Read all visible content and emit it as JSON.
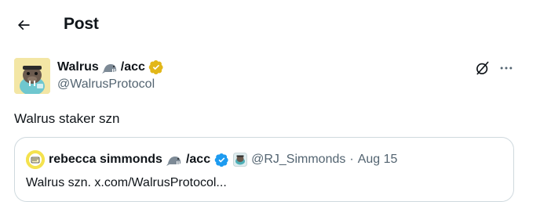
{
  "header": {
    "title": "Post"
  },
  "author": {
    "name": "Walrus",
    "name_suffix": "/acc",
    "handle": "@WalrusProtocol",
    "badge_color": "#e2b719"
  },
  "post": {
    "text": "Walrus staker szn"
  },
  "quoted": {
    "name": "rebecca simmonds",
    "name_suffix": "/acc",
    "handle": "@RJ_Simmonds",
    "separator": "·",
    "date": "Aug 15",
    "text": "Walrus szn. x.com/WalrusProtocol...",
    "badge_color": "#1d9bf0"
  },
  "icons": {
    "back": "arrow-left-icon",
    "grok": "grok-icon",
    "more": "more-icon",
    "walrus_emoji": "walrus-emoji-icon",
    "verified_gold": "verified-gold-icon",
    "verified_blue": "verified-blue-icon",
    "affiliate": "affiliate-badge-icon"
  }
}
